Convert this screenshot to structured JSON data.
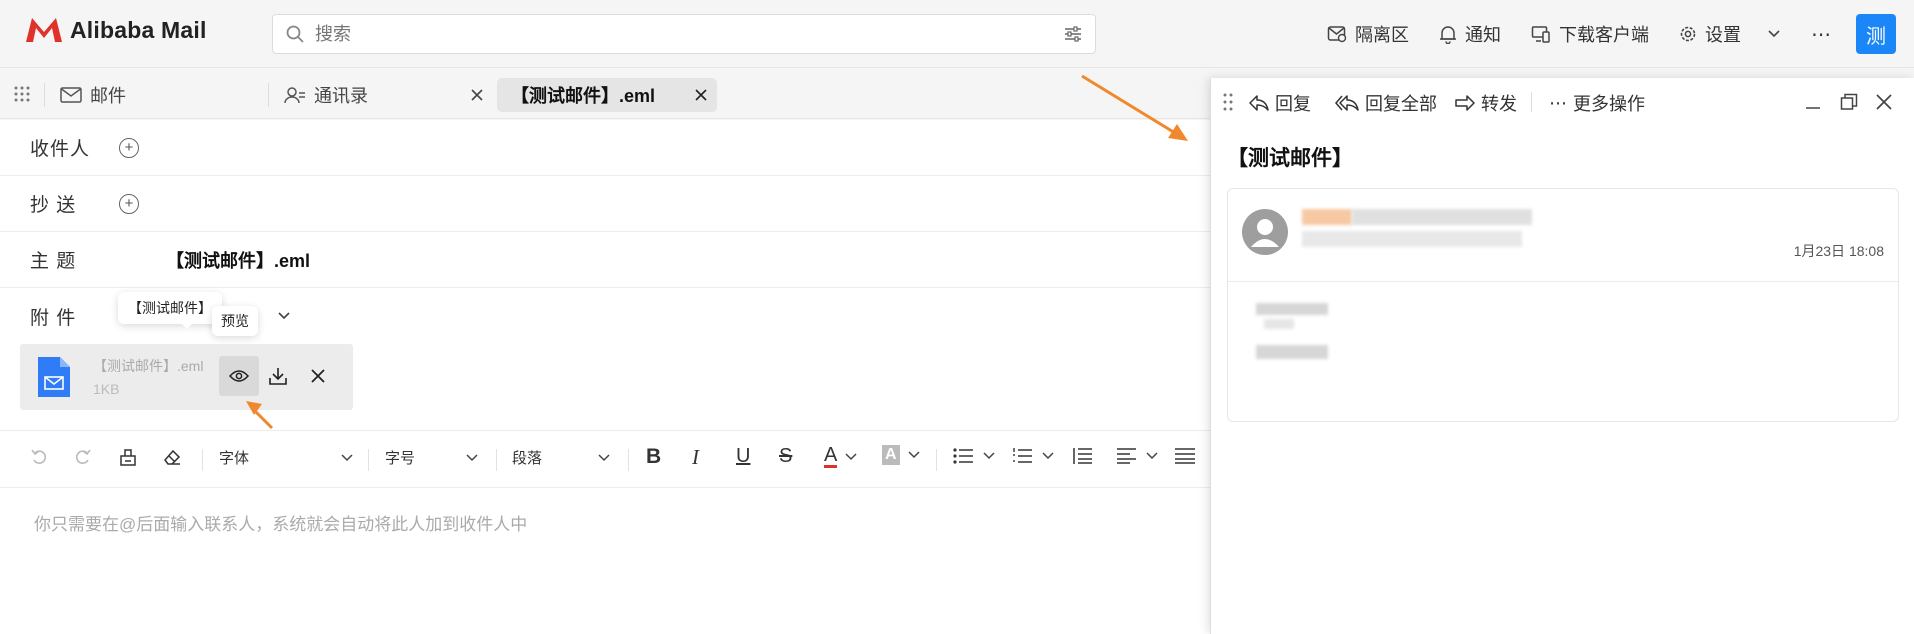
{
  "app": {
    "brand": "Alibaba Mail"
  },
  "search": {
    "placeholder": "搜索"
  },
  "top_actions": {
    "quarantine": "隔离区",
    "notify": "通知",
    "download": "下载客户端",
    "settings": "设置",
    "avatar": "测"
  },
  "tabs": {
    "mail": "邮件",
    "contacts": "通讯录",
    "active": "【测试邮件】.eml"
  },
  "compose": {
    "to_label": "收件人",
    "cc_label": "抄 送",
    "subject_label": "主 题",
    "subject_value": "【测试邮件】.eml",
    "attach_label": "附 件",
    "attachment": {
      "name": "【测试邮件】.eml",
      "size": "1KB"
    },
    "tooltip_name": "【测试邮件】",
    "tooltip_preview": "预览",
    "body_placeholder": "你只需要在@后面输入联系人，系统就会自动将此人加到收件人中"
  },
  "toolbar": {
    "font": "字体",
    "size": "字号",
    "paragraph": "段落",
    "bold": "B",
    "italic": "I",
    "underline": "U",
    "strike": "S",
    "font_color": "A",
    "bg_color": "A"
  },
  "panel": {
    "reply": "回复",
    "reply_all": "回复全部",
    "forward": "转发",
    "more": "更多操作",
    "title": "【测试邮件】",
    "date": "1月23日 18:08"
  },
  "colors": {
    "accent": "#1a86f7",
    "logo": "#e0322b",
    "arrow": "#f0892e"
  }
}
